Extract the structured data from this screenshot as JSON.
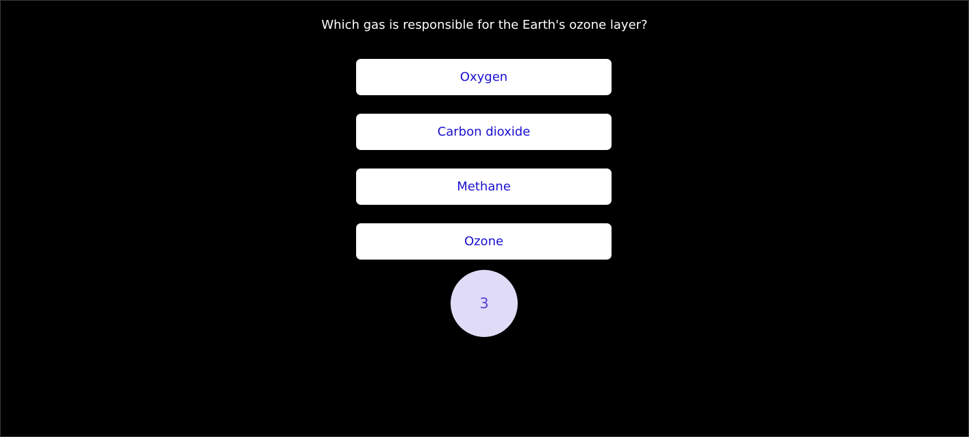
{
  "question": {
    "text": "Which gas is responsible for the Earth's ozone layer?"
  },
  "answers": [
    {
      "label": "Oxygen"
    },
    {
      "label": "Carbon dioxide"
    },
    {
      "label": "Methane"
    },
    {
      "label": "Ozone"
    }
  ],
  "timer": {
    "value": "3"
  },
  "colors": {
    "background": "#000000",
    "question_text": "#ffffff",
    "answer_background": "#ffffff",
    "answer_text": "#1a0fd0",
    "timer_background": "#e0dcf7",
    "timer_text": "#5a3fd0"
  }
}
